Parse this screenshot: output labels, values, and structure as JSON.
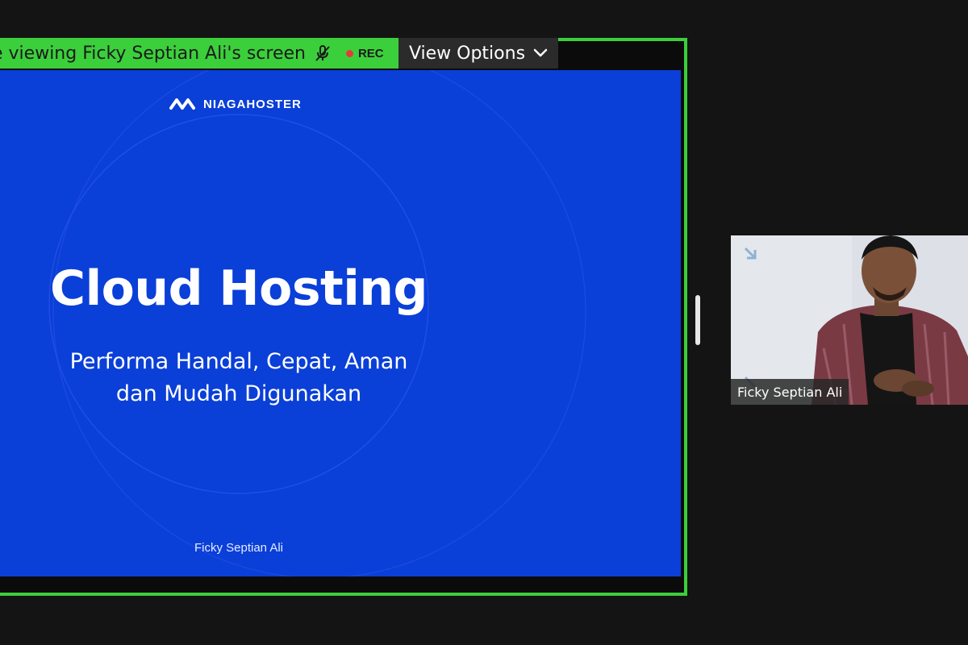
{
  "share_bar": {
    "viewing_text": "e viewing Ficky Septian Ali's screen",
    "mic_icon": "mic-muted-icon",
    "rec_label": "REC",
    "accent_color": "#3ccf3c"
  },
  "view_options": {
    "label": "View Options",
    "icon": "chevron-down-icon"
  },
  "slide": {
    "brand": "NIAGAHOSTER",
    "title": "Cloud Hosting",
    "subtitle_line1": "Performa Handal, Cepat, Aman",
    "subtitle_line2": "dan Mudah Digunakan",
    "author": "Ficky Septian Ali",
    "background_color": "#0a3fd8"
  },
  "participant": {
    "name": "Ficky Septian Ali"
  }
}
